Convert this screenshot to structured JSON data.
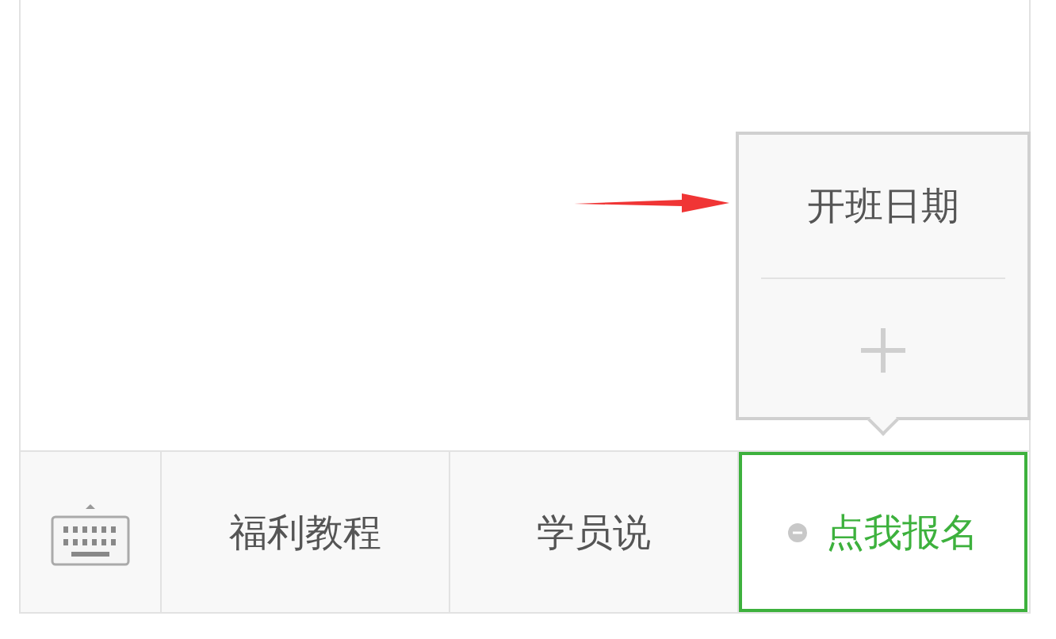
{
  "popup_menu": {
    "items": [
      {
        "kind": "text",
        "label": "开班日期"
      },
      {
        "kind": "add"
      }
    ]
  },
  "bottom_bar": {
    "items": [
      {
        "kind": "keyboard",
        "selected": false
      },
      {
        "kind": "text",
        "label": "福利教程",
        "selected": false
      },
      {
        "kind": "text",
        "label": "学员说",
        "selected": false
      },
      {
        "kind": "menu",
        "label": "点我报名",
        "selected": true
      }
    ]
  }
}
